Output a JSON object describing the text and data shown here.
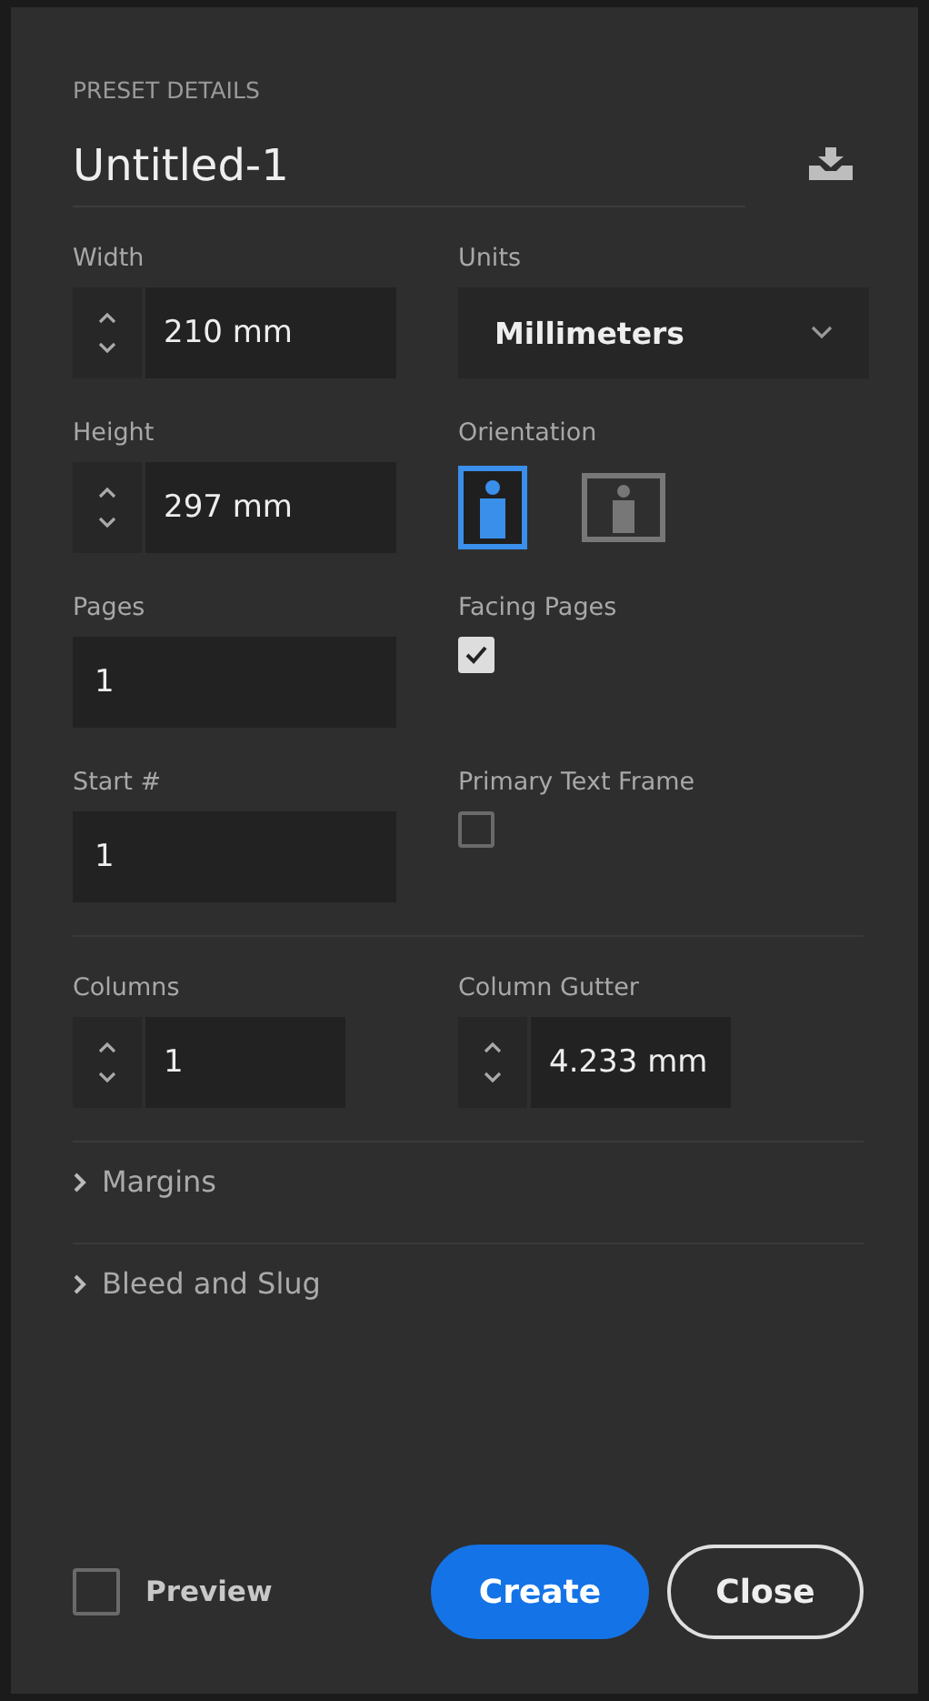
{
  "section_title": "PRESET DETAILS",
  "document_name": "Untitled-1",
  "width": {
    "label": "Width",
    "value": "210 mm"
  },
  "units": {
    "label": "Units",
    "value": "Millimeters"
  },
  "height": {
    "label": "Height",
    "value": "297 mm"
  },
  "orientation": {
    "label": "Orientation",
    "options": [
      {
        "kind": "portrait",
        "selected": true
      },
      {
        "kind": "landscape",
        "selected": false
      }
    ]
  },
  "pages": {
    "label": "Pages",
    "value": "1"
  },
  "facing_pages": {
    "label": "Facing Pages",
    "checked": true
  },
  "start": {
    "label": "Start #",
    "value": "1"
  },
  "primary_text_frame": {
    "label": "Primary Text Frame",
    "checked": false
  },
  "columns": {
    "label": "Columns",
    "value": "1"
  },
  "column_gutter": {
    "label": "Column Gutter",
    "value": "4.233 mm"
  },
  "sections": [
    {
      "label": "Margins",
      "expanded": false
    },
    {
      "label": "Bleed and Slug",
      "expanded": false
    }
  ],
  "preview": {
    "label": "Preview",
    "checked": false
  },
  "buttons": [
    {
      "label": "Create",
      "kind": "primary"
    },
    {
      "label": "Close",
      "kind": "secondary"
    }
  ]
}
